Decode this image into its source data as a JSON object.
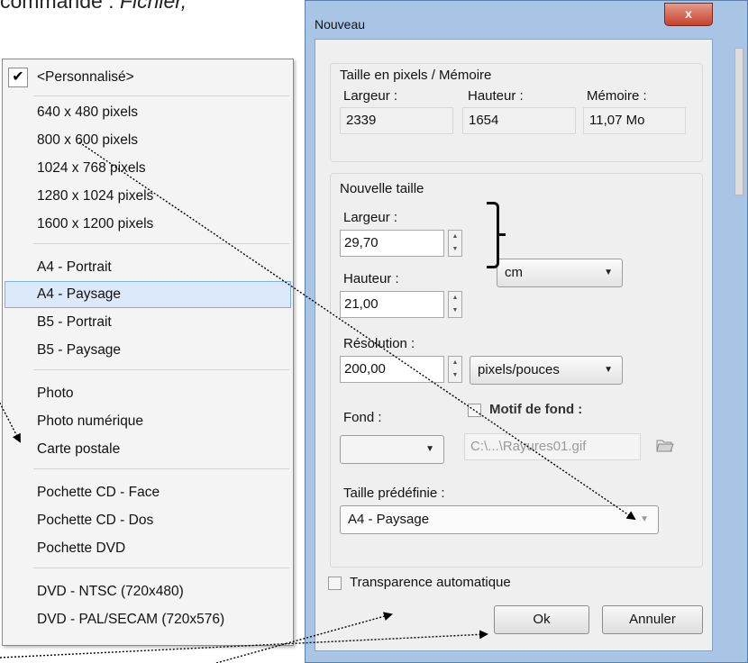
{
  "doc": {
    "caption_plain": "commande : ",
    "caption_italic": "Fichier,"
  },
  "presets": {
    "checked_item": "<Personnalisé>",
    "check_glyph": "✔",
    "items": [
      "640 x 480 pixels",
      "800 x 600 pixels",
      "1024 x 768 pixels",
      "1280 x 1024 pixels",
      "1600 x 1200 pixels",
      "A4 - Portrait",
      "A4 - Paysage",
      "B5 - Portrait",
      "B5 - Paysage",
      "Photo",
      "Photo numérique",
      "Carte postale",
      "Pochette CD - Face",
      "Pochette CD - Dos",
      "Pochette DVD",
      "DVD - NTSC (720x480)",
      "DVD - PAL/SECAM (720x576)"
    ],
    "selected": "A4 - Paysage"
  },
  "dialog": {
    "title": "Nouveau",
    "close_glyph": "x",
    "pixels_group": {
      "title": "Taille en pixels / Mémoire",
      "width_label": "Largeur :",
      "height_label": "Hauteur :",
      "memory_label": "Mémoire :",
      "width_value": "2339",
      "height_value": "1654",
      "memory_value": "11,07 Mo"
    },
    "new_size_group": {
      "title": "Nouvelle taille",
      "width_label": "Largeur :",
      "width_value": "29,70",
      "height_label": "Hauteur :",
      "height_value": "21,00",
      "unit_value": "cm",
      "resolution_label": "Résolution :",
      "resolution_value": "200,00",
      "resolution_unit": "pixels/pouces",
      "background_label": "Fond :",
      "pattern_label": "Motif de fond :",
      "pattern_file": "C:\\...\\Rayures01.gif",
      "preset_label": "Taille prédéfinie :",
      "preset_value": "A4 - Paysage"
    },
    "auto_transparency_label": "Transparence automatique",
    "ok_label": "Ok",
    "cancel_label": "Annuler"
  },
  "icons": {
    "spin_up": "▲",
    "spin_down": "▼",
    "dropdown": "▼",
    "folder_open": "folder-open-icon"
  }
}
